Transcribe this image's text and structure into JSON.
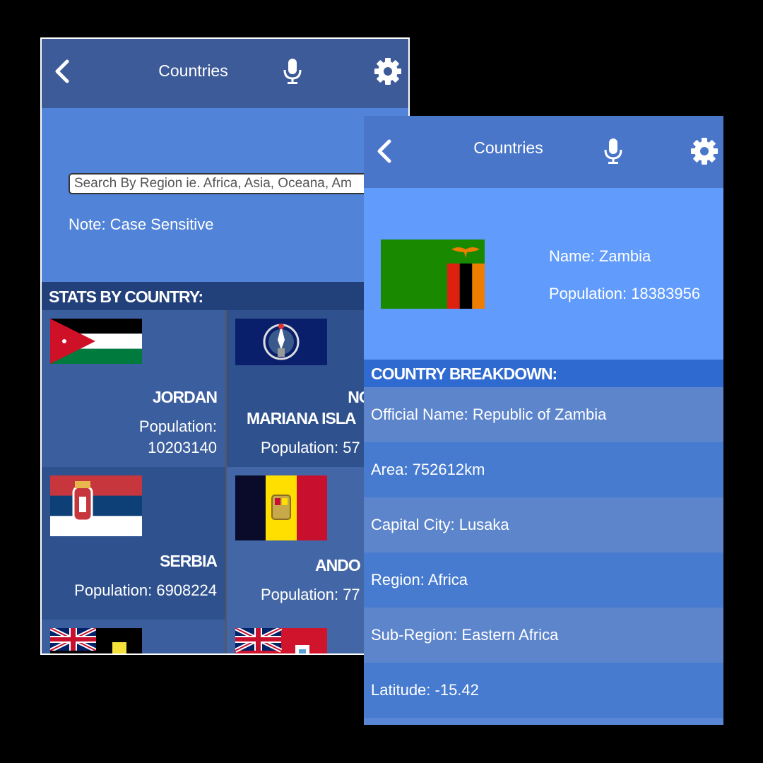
{
  "list_screen": {
    "header": {
      "title": "Countries",
      "back_icon": "chevron-left-icon",
      "mic_icon": "microphone-icon",
      "settings_icon": "gear-icon"
    },
    "search": {
      "placeholder": "Search By Region ie. Africa, Asia, Oceana, Am"
    },
    "note": "Note: Case Sensitive",
    "section_title": "STATS BY COUNTRY:",
    "countries": [
      {
        "name": "JORDAN",
        "population_label": "Population:",
        "population_value": "10203140",
        "flag": "jordan-flag"
      },
      {
        "name_line1": "NORTH",
        "name_line2": "MARIANA ISLA",
        "population": "Population: 57",
        "flag": "northern-mariana-islands-flag"
      },
      {
        "name": "SERBIA",
        "population": "Population: 6908224",
        "flag": "serbia-flag"
      },
      {
        "name": "ANDO",
        "population": "Population: 77",
        "flag": "andorra-flag"
      },
      {
        "flag": "turks-and-caicos-flag"
      },
      {
        "flag": "bermuda-flag"
      }
    ]
  },
  "detail_screen": {
    "header": {
      "title": "Countries",
      "back_icon": "chevron-left-icon",
      "mic_icon": "microphone-icon",
      "settings_icon": "gear-icon"
    },
    "flag": "zambia-flag",
    "name": "Name: Zambia",
    "population": "Population: 18383956",
    "section_title": "COUNTRY BREAKDOWN:",
    "rows": [
      "Official Name: Republic of Zambia",
      "Area: 752612km",
      "Capital City: Lusaka",
      "Region: Africa",
      "Sub-Region: Eastern Africa",
      "Latitude: -15.42"
    ]
  },
  "colors": {
    "header": "#3d5b98",
    "search_bg": "#5183d8",
    "hero_bg": "#619bfb",
    "section_dark": "#22407a"
  }
}
